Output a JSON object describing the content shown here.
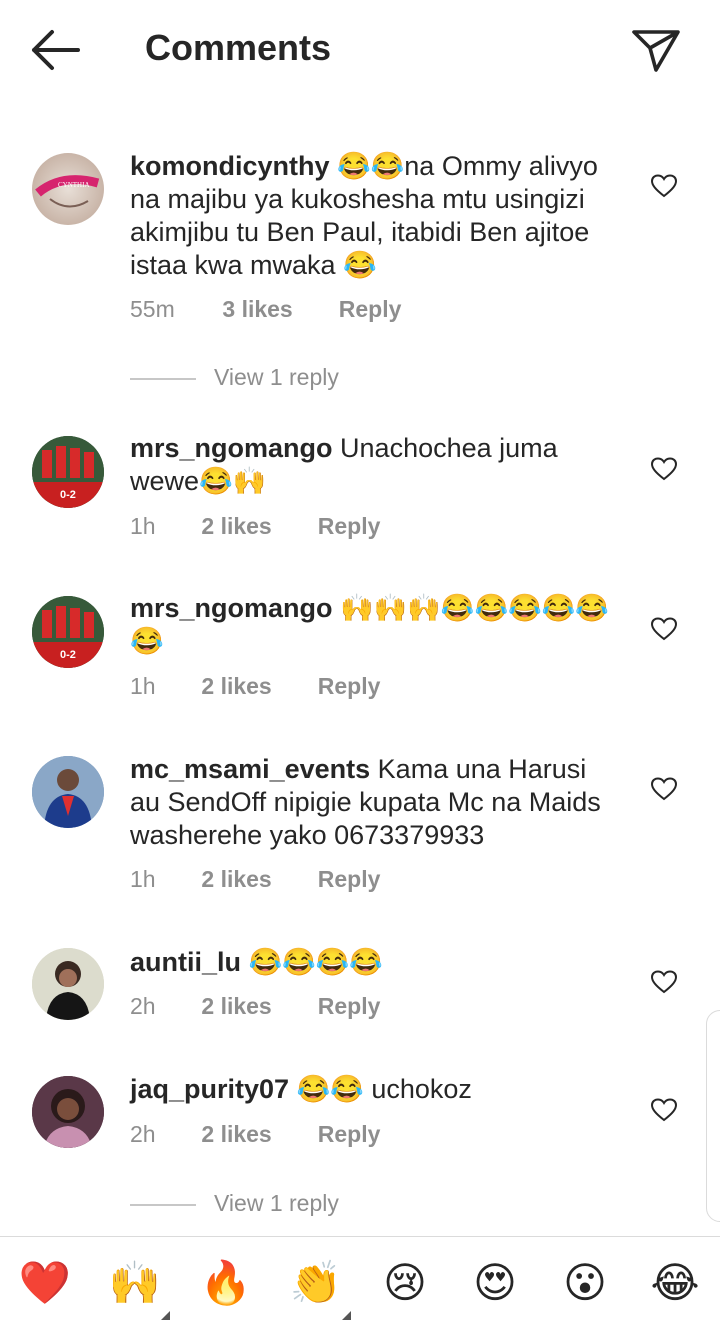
{
  "header": {
    "title": "Comments"
  },
  "comments": [
    {
      "username": "komondicynthy",
      "text": "😂😂na Ommy alivyo na majibu ya kukoshesha mtu usingizi akimjibu tu Ben Paul, itabidi Ben ajitoe istaa kwa mwaka 😂",
      "time": "55m",
      "likes": "3 likes",
      "reply": "Reply",
      "avatar_text": "CYNTHIA"
    },
    {
      "username": "mrs_ngomango",
      "text": "Unachochea juma wewe😂🙌",
      "time": "1h",
      "likes": "2 likes",
      "reply": "Reply",
      "avatar_text": "0-2"
    },
    {
      "username": "mrs_ngomango",
      "text": "🙌🙌🙌😂😂😂😂😂😂",
      "time": "1h",
      "likes": "2 likes",
      "reply": "Reply",
      "avatar_text": "0-2"
    },
    {
      "username": "mc_msami_events",
      "text": "Kama una Harusi au SendOff nipigie kupata Mc na Maids washerehe yako 0673379933",
      "time": "1h",
      "likes": "2 likes",
      "reply": "Reply"
    },
    {
      "username": "auntii_lu",
      "text": "😂😂😂😂",
      "time": "2h",
      "likes": "2 likes",
      "reply": "Reply"
    },
    {
      "username": "jaq_purity07",
      "text": "😂😂 uchokoz",
      "time": "2h",
      "likes": "2 likes",
      "reply": "Reply"
    }
  ],
  "view_replies": [
    "View 1 reply",
    "View 1 reply"
  ],
  "reactions": [
    "❤️",
    "🙌",
    "🔥",
    "👏",
    "😢",
    "😍",
    "😮",
    "😂"
  ],
  "colors": {
    "heart_red": "#ed4956",
    "meta_gray": "#8e8e8e",
    "text_dark": "#262626"
  }
}
